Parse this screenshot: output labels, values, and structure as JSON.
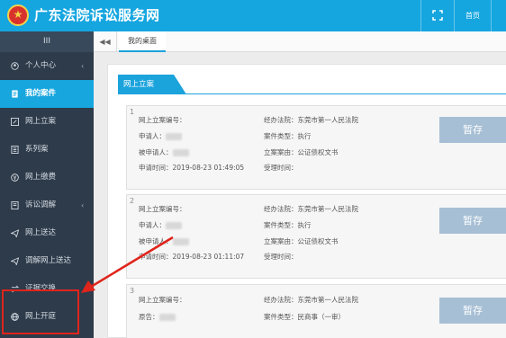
{
  "header": {
    "title": "广东法院诉讼服务网",
    "home_label": "首页",
    "bg_color": "#15a6e0"
  },
  "sidebar": {
    "toggle_label": "III",
    "items": [
      {
        "label": "个人中心",
        "icon": "user-icon",
        "has_chevron": true,
        "chevron": "‹",
        "active": false
      },
      {
        "label": "我的案件",
        "icon": "document-icon",
        "active": true
      },
      {
        "label": "网上立案",
        "icon": "edit-icon",
        "active": false
      },
      {
        "label": "系列案",
        "icon": "list-icon",
        "active": false
      },
      {
        "label": "网上缴费",
        "icon": "yen-icon",
        "active": false
      },
      {
        "label": "诉讼调解",
        "icon": "mediation-icon",
        "has_chevron": true,
        "chevron": "‹",
        "active": false
      },
      {
        "label": "网上送达",
        "icon": "send-icon",
        "active": false
      },
      {
        "label": "调解网上送达",
        "icon": "send-icon",
        "active": false
      },
      {
        "label": "证据交换",
        "icon": "exchange-icon",
        "active": false
      },
      {
        "label": "网上开庭",
        "icon": "globe-icon",
        "active": false
      }
    ]
  },
  "tabbar": {
    "back_glyph": "◀◀",
    "tabs": [
      {
        "label": "我的桌面"
      }
    ]
  },
  "section": {
    "title": "网上立案"
  },
  "cards": [
    {
      "number": "1",
      "case_no_label": "网上立案编号：",
      "applicant_label": "申请人：",
      "respondent_label": "被申请人：",
      "apply_time_label": "申请时间：",
      "apply_time": "2019-08-23 01:49:05",
      "court": "经办法院：东莞市第一人民法院",
      "case_type": "案件类型：执行",
      "cause": "立案案由：公证债权文书",
      "accept_time": "受理时间：",
      "save_label": "暂存"
    },
    {
      "number": "2",
      "case_no_label": "网上立案编号：",
      "applicant_label": "申请人：",
      "respondent_label": "被申请人：",
      "apply_time_label": "申请时间：",
      "apply_time": "2019-08-23 01:11:07",
      "court": "经办法院：东莞市第一人民法院",
      "case_type": "案件类型：执行",
      "cause": "立案案由：公证债权文书",
      "accept_time": "受理时间：",
      "save_label": "暂存"
    },
    {
      "number": "3",
      "case_no_label": "网上立案编号：",
      "applicant_label": "原告：",
      "court": "经办法院：东莞市第一人民法院",
      "case_type": "案件类型：民商事（一审）",
      "save_label": "暂存"
    }
  ],
  "annotation": {
    "color": "#e0241b"
  }
}
